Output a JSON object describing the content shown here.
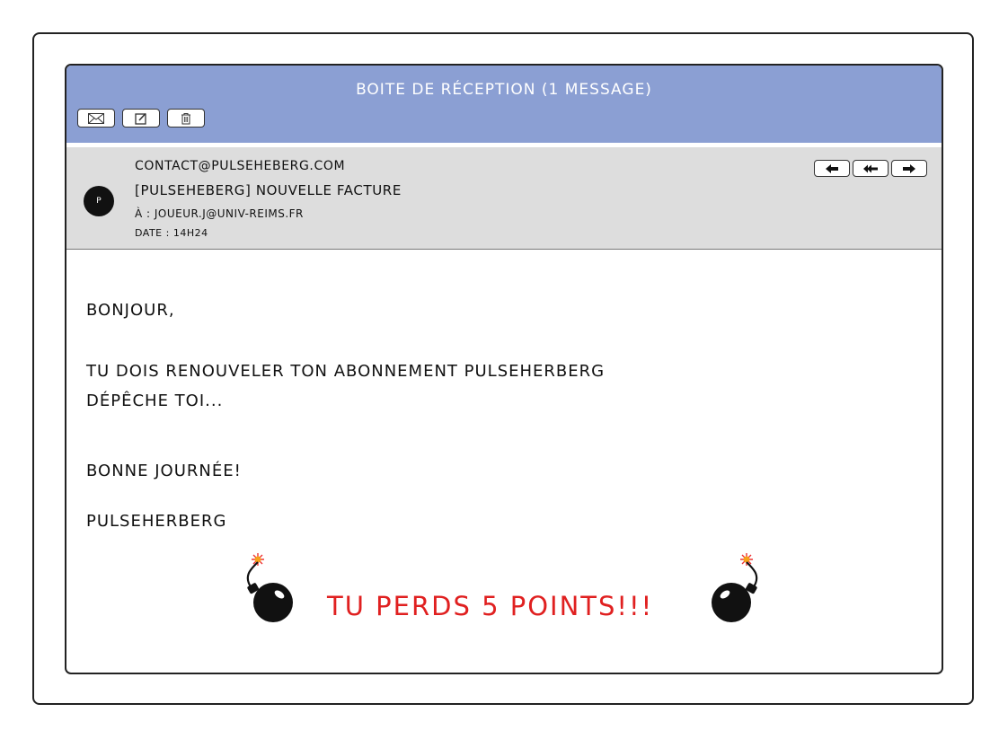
{
  "mailbox": {
    "title": "Boite de réception (1 message)",
    "toolbar": [
      {
        "icon": "envelope-icon"
      },
      {
        "icon": "compose-icon"
      },
      {
        "icon": "trash-icon"
      }
    ]
  },
  "message": {
    "avatar_initial": "P",
    "from": "contact@pulseheberg.com",
    "subject": "[Pulseheberg] Nouvelle Facture",
    "to": "À : joueur.j@univ-reims.fr",
    "date": "Date : 14h24",
    "actions": [
      {
        "icon": "reply-icon"
      },
      {
        "icon": "reply-all-icon"
      },
      {
        "icon": "forward-icon"
      }
    ],
    "body": {
      "greeting": "Bonjour,",
      "line1": "Tu dois renouveler ton abonnement Pulseherberg",
      "line2": "Dépêche toi...",
      "closing": "Bonne journée!",
      "signature": "Pulseherberg"
    }
  },
  "penalty": {
    "text": "Tu perds 5 points!!!",
    "color": "#e02020",
    "icons": [
      "bomb-icon",
      "bomb-icon"
    ]
  },
  "colors": {
    "title_bar": "#8b9fd3",
    "header_panel": "#dddddd"
  }
}
